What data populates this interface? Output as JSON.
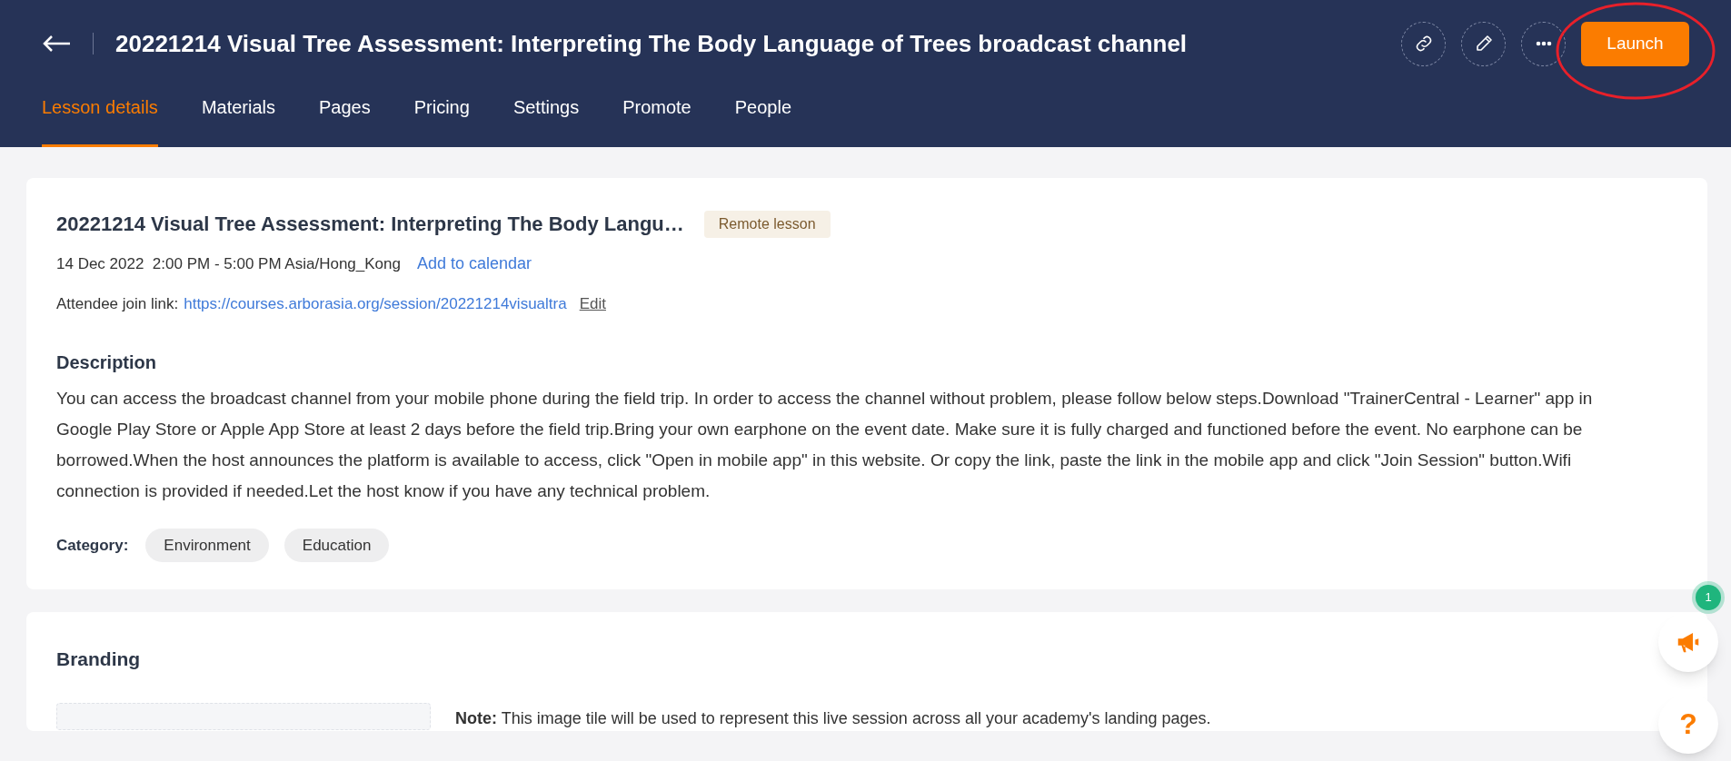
{
  "header": {
    "title": "20221214 Visual Tree Assessment: Interpreting The Body Language of Trees broadcast channel",
    "launch_button": "Launch"
  },
  "tabs": [
    {
      "label": "Lesson details",
      "selected": true
    },
    {
      "label": "Materials",
      "selected": false
    },
    {
      "label": "Pages",
      "selected": false
    },
    {
      "label": "Pricing",
      "selected": false
    },
    {
      "label": "Settings",
      "selected": false
    },
    {
      "label": "Promote",
      "selected": false
    },
    {
      "label": "People",
      "selected": false
    }
  ],
  "lesson": {
    "title": "20221214 Visual Tree Assessment: Interpreting The Body Langu…",
    "badge": "Remote lesson",
    "schedule": "14 Dec 2022  2:00 PM - 5:00 PM Asia/Hong_Kong",
    "calendar_link": "Add to calendar",
    "join_label": "Attendee join link:",
    "join_link": "https://courses.arborasia.org/session/20221214visualtra",
    "edit_link": "Edit",
    "description_heading": "Description",
    "description": "You can access the broadcast channel from your mobile phone during the field trip. In order to access the channel without problem, please follow below steps.Download \"TrainerCentral - Learner\" app in Google Play Store or Apple App Store at least 2 days before the field trip.Bring your own earphone on the event date. Make sure it is fully charged and functioned before the event. No earphone can be borrowed.When the host announces the platform is available to access, click \"Open in mobile app\" in this website. Or copy the link, paste the link in the mobile app and click \"Join Session\" button.Wifi connection is provided if needed.Let the host know if you have any technical problem.",
    "category_label": "Category:",
    "categories": [
      "Environment",
      "Education"
    ]
  },
  "branding": {
    "heading": "Branding",
    "note": "**Note:** This image tile will be used to represent this live session across all your academy's landing pages."
  },
  "notifications": {
    "count": "1"
  },
  "help": {
    "label": "?"
  }
}
